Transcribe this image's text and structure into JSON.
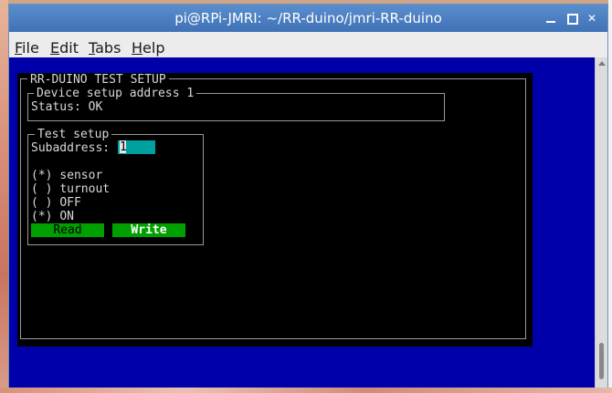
{
  "window": {
    "title": "pi@RPi-JMRI: ~/RR-duino/jmri-RR-duino"
  },
  "menu": {
    "items": [
      "File",
      "Edit",
      "Tabs",
      "Help"
    ]
  },
  "terminal": {
    "dialog_title": "RR-DUINO TEST SETUP",
    "device_frame_title": "Device setup address 1",
    "status_text": "Status: OK",
    "test_frame_title": "Test setup",
    "subaddress_label": "Subaddress:",
    "subaddress_value": "1",
    "radios": [
      {
        "mark": "(*)",
        "label": "sensor"
      },
      {
        "mark": "( )",
        "label": "turnout"
      },
      {
        "mark": "( )",
        "label": "OFF"
      },
      {
        "mark": "(*)",
        "label": "ON"
      }
    ],
    "read_button": "Read",
    "write_button": "Write"
  },
  "colors": {
    "terminal_bg": "#0000aa",
    "dialog_bg": "#000000",
    "button_green": "#00a000",
    "field_cyan": "#00a0a0",
    "titlebar": "#4a7fc1"
  }
}
